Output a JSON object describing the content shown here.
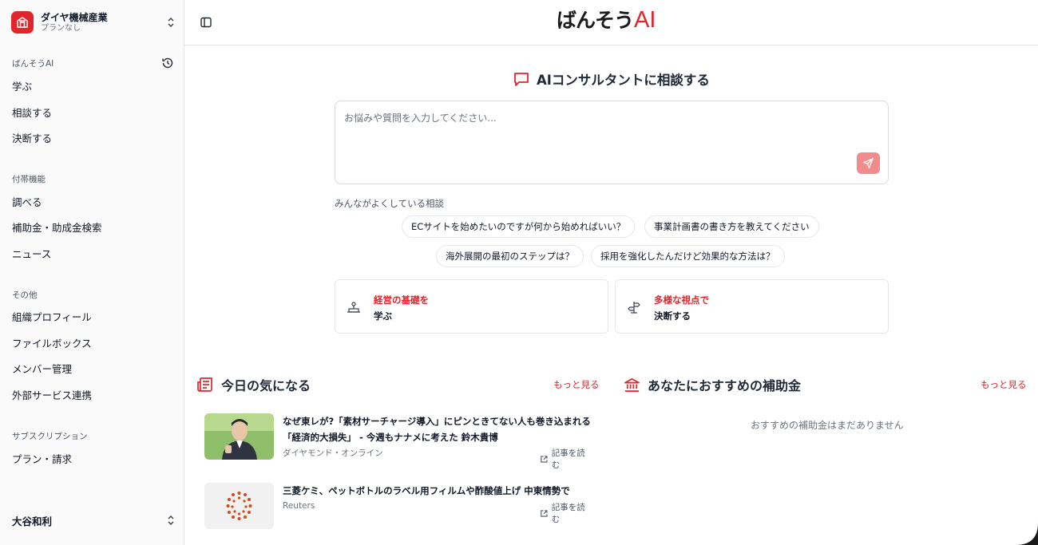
{
  "sidebar": {
    "org": {
      "name": "ダイヤ機械産業",
      "plan": "プランなし"
    },
    "sections": [
      {
        "label": "ばんそうAI",
        "items": [
          "学ぶ",
          "相談する",
          "決断する"
        ]
      },
      {
        "label": "付帯機能",
        "items": [
          "調べる",
          "補助金・助成金検索",
          "ニュース"
        ]
      },
      {
        "label": "その他",
        "items": [
          "組織プロフィール",
          "ファイルボックス",
          "メンバー管理",
          "外部サービス連携"
        ]
      },
      {
        "label": "サブスクリプション",
        "items": [
          "プラン・請求"
        ]
      }
    ],
    "user": {
      "name": "大谷和利"
    }
  },
  "header": {
    "brand_jp": "ばんそう",
    "brand_ai": "AI"
  },
  "main": {
    "title": "AIコンサルタントに相談する",
    "prompt_placeholder": "お悩みや質問を入力してください...",
    "popular_label": "みんながよくしている相談",
    "chips": [
      "ECサイトを始めたいのですが何から始めればいい？",
      "事業計画書の書き方を教えてください",
      "海外展開の最初のステップは？",
      "採用を強化したんだけど効果的な方法は？"
    ],
    "cards": [
      {
        "top": "経営の基礎を",
        "bottom": "学ぶ"
      },
      {
        "top": "多様な視点で",
        "bottom": "決断する"
      }
    ],
    "news": {
      "title": "今日の気になる",
      "more": "もっと見る",
      "read_label": "記事を読む",
      "items": [
        {
          "title": "なぜ東レが?「素材サーチャージ導入」にピンときてない人も巻き込まれる「経済的大損失」 - 今週もナナメに考えた 鈴木貴博",
          "source": "ダイヤモンド・オンライン"
        },
        {
          "title": "三菱ケミ、ペットボトルのラベル用フィルムや酢酸値上げ 中東情勢で",
          "source": "Reuters"
        }
      ]
    },
    "subsidy": {
      "title": "あなたにおすすめの補助金",
      "more": "もっと見る",
      "empty": "おすすめの補助金はまだありません"
    }
  },
  "colors": {
    "accent": "#e1262b",
    "send_button": "#f28b8b",
    "sidebar_bg": "#fafafa"
  }
}
